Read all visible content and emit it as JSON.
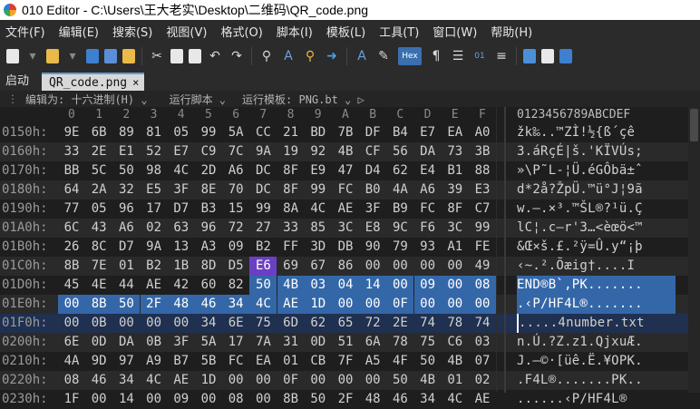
{
  "window": {
    "title": "010 Editor - C:\\Users\\王大老实\\Desktop\\二维码\\QR_code.png"
  },
  "menu": [
    "文件(F)",
    "编辑(E)",
    "搜索(S)",
    "视图(V)",
    "格式(O)",
    "脚本(I)",
    "模板(L)",
    "工具(T)",
    "窗口(W)",
    "帮助(H)"
  ],
  "toolbar": {
    "hex_label": "Hex"
  },
  "tabs": {
    "home": "启动",
    "file": "QR_code.png",
    "close": "×"
  },
  "edit_row": {
    "edit_as": "编辑为: 十六进制(H) ⌄",
    "run_script": "运行脚本 ⌄",
    "run_template": "运行模板: PNG.bt ⌄ ▷"
  },
  "column_header": {
    "hex": [
      "0",
      "1",
      "2",
      "3",
      "4",
      "5",
      "6",
      "7",
      "8",
      "9",
      "A",
      "B",
      "C",
      "D",
      "E",
      "F"
    ],
    "ascii": "0123456789ABCDEF"
  },
  "rows": [
    {
      "addr": "0150h:",
      "bytes": [
        "9E",
        "6B",
        "89",
        "81",
        "05",
        "99",
        "5A",
        "CC",
        "21",
        "BD",
        "7B",
        "DF",
        "B4",
        "E7",
        "EA",
        "A0"
      ],
      "ascii": "žk‰..™ZÌ!½{ß´çê "
    },
    {
      "addr": "0160h:",
      "bytes": [
        "33",
        "2E",
        "E1",
        "52",
        "E7",
        "C9",
        "7C",
        "9A",
        "19",
        "92",
        "4B",
        "CF",
        "56",
        "DA",
        "73",
        "3B"
      ],
      "ascii": "3.áRçÉ|š.'KÏVÚs;"
    },
    {
      "addr": "0170h:",
      "bytes": [
        "BB",
        "5C",
        "50",
        "98",
        "4C",
        "2D",
        "A6",
        "DC",
        "8F",
        "E9",
        "47",
        "D4",
        "62",
        "E4",
        "B1",
        "88"
      ],
      "ascii": "»\\P˜L-¦Ü.éGÔbä±ˆ"
    },
    {
      "addr": "0180h:",
      "bytes": [
        "64",
        "2A",
        "32",
        "E5",
        "3F",
        "8E",
        "70",
        "DC",
        "8F",
        "99",
        "FC",
        "B0",
        "4A",
        "A6",
        "39",
        "E3"
      ],
      "ascii": "d*2å?ŽpÜ.™ü°J¦9ã"
    },
    {
      "addr": "0190h:",
      "bytes": [
        "77",
        "05",
        "96",
        "17",
        "D7",
        "B3",
        "15",
        "99",
        "8A",
        "4C",
        "AE",
        "3F",
        "B9",
        "FC",
        "8F",
        "C7"
      ],
      "ascii": "w.–.×³.™ŠL®?¹ü.Ç"
    },
    {
      "addr": "01A0h:",
      "bytes": [
        "6C",
        "43",
        "A6",
        "02",
        "63",
        "96",
        "72",
        "27",
        "33",
        "85",
        "3C",
        "E8",
        "9C",
        "F6",
        "3C",
        "99"
      ],
      "ascii": "lC¦.c–r'3…<èœö<™"
    },
    {
      "addr": "01B0h:",
      "bytes": [
        "26",
        "8C",
        "D7",
        "9A",
        "13",
        "A3",
        "09",
        "B2",
        "FF",
        "3D",
        "DB",
        "90",
        "79",
        "93",
        "A1",
        "FE"
      ],
      "ascii": "&Œ×š.£.²ÿ=Û.y“¡þ"
    },
    {
      "addr": "01C0h:",
      "bytes": [
        "8B",
        "7E",
        "01",
        "B2",
        "1B",
        "8D",
        "D5",
        "E6",
        "69",
        "67",
        "86",
        "00",
        "00",
        "00",
        "00",
        "49"
      ],
      "ascii": "‹~.².Õæig†....I"
    },
    {
      "addr": "01D0h:",
      "bytes": [
        "45",
        "4E",
        "44",
        "AE",
        "42",
        "60",
        "82",
        "50",
        "4B",
        "03",
        "04",
        "14",
        "00",
        "09",
        "00",
        "08"
      ],
      "ascii": "END®B`‚PK......."
    },
    {
      "addr": "01E0h:",
      "bytes": [
        "00",
        "8B",
        "50",
        "2F",
        "48",
        "46",
        "34",
        "4C",
        "AE",
        "1D",
        "00",
        "00",
        "0F",
        "00",
        "00",
        "00"
      ],
      "ascii": ".‹P/HF4L®......."
    },
    {
      "addr": "01F0h:",
      "bytes": [
        "00",
        "0B",
        "00",
        "00",
        "00",
        "34",
        "6E",
        "75",
        "6D",
        "62",
        "65",
        "72",
        "2E",
        "74",
        "78",
        "74"
      ],
      "ascii": ".....4number.txt"
    },
    {
      "addr": "0200h:",
      "bytes": [
        "6E",
        "0D",
        "DA",
        "0B",
        "3F",
        "5A",
        "17",
        "7A",
        "31",
        "0D",
        "51",
        "6A",
        "78",
        "75",
        "C6",
        "03"
      ],
      "ascii": "n.Ú.?Z.z1.QjxuÆ."
    },
    {
      "addr": "0210h:",
      "bytes": [
        "4A",
        "9D",
        "97",
        "A9",
        "B7",
        "5B",
        "FC",
        "EA",
        "01",
        "CB",
        "7F",
        "A5",
        "4F",
        "50",
        "4B",
        "07"
      ],
      "ascii": "J.—©·[üê.Ë.¥OPK."
    },
    {
      "addr": "0220h:",
      "bytes": [
        "08",
        "46",
        "34",
        "4C",
        "AE",
        "1D",
        "00",
        "00",
        "0F",
        "00",
        "00",
        "00",
        "50",
        "4B",
        "01",
        "02"
      ],
      "ascii": ".F4L®.......PK.."
    },
    {
      "addr": "0230h:",
      "bytes": [
        "1F",
        "00",
        "14",
        "00",
        "09",
        "00",
        "08",
        "00",
        "8B",
        "50",
        "2F",
        "48",
        "46",
        "34",
        "4C",
        "AE"
      ],
      "ascii": "......‹P/HF4L®"
    }
  ],
  "highlight": {
    "blue": "#3467a8",
    "purple": "#6b3fc4"
  }
}
